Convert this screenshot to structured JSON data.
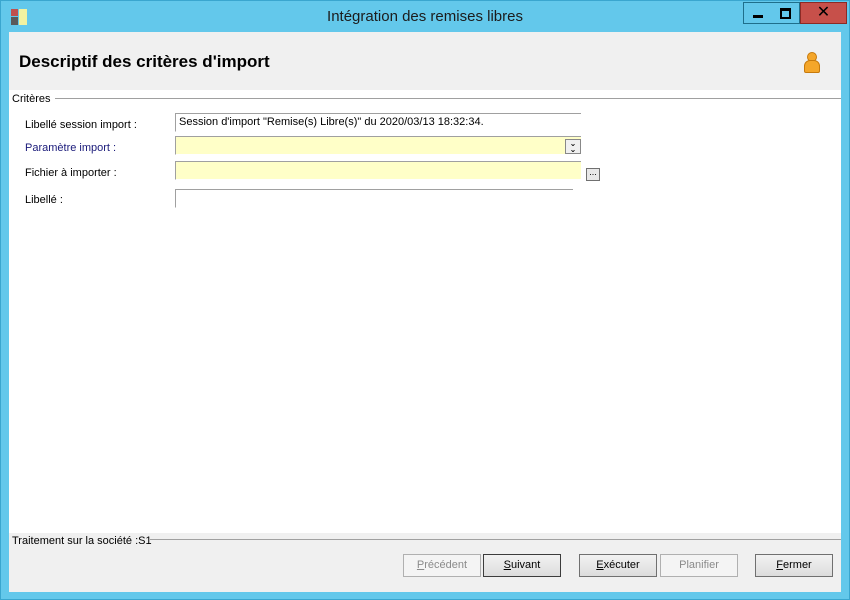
{
  "window": {
    "title": "Intégration des remises libres",
    "colors": {
      "frame": "#63c8eb",
      "close": "#c7504a",
      "field_yellow": "#ffffc8"
    }
  },
  "header": {
    "title": "Descriptif des critères d'import",
    "icon": "user-icon"
  },
  "criteria": {
    "group_label": "Critères",
    "session_label": "Libellé session import :",
    "session_value": "Session d'import \"Remise(s) Libre(s)\" du 2020/03/13 18:32:34.",
    "param_label": "Paramètre import :",
    "param_value": "",
    "file_label": "Fichier à importer :",
    "file_value": "",
    "browse_label": "...",
    "libelle_label": "Libellé :",
    "libelle_value": ""
  },
  "footer": {
    "label": "Traitement sur la société :S1",
    "buttons": {
      "precedent": {
        "first": "P",
        "rest": "récédent",
        "enabled": false
      },
      "suivant": {
        "first": "S",
        "rest": "uivant",
        "enabled": true
      },
      "executer": {
        "first": "E",
        "rest": "xécuter",
        "enabled": true
      },
      "planifier": {
        "first": "",
        "rest": "Planifier",
        "enabled": false
      },
      "fermer": {
        "first": "F",
        "rest": "ermer",
        "enabled": true
      }
    }
  }
}
